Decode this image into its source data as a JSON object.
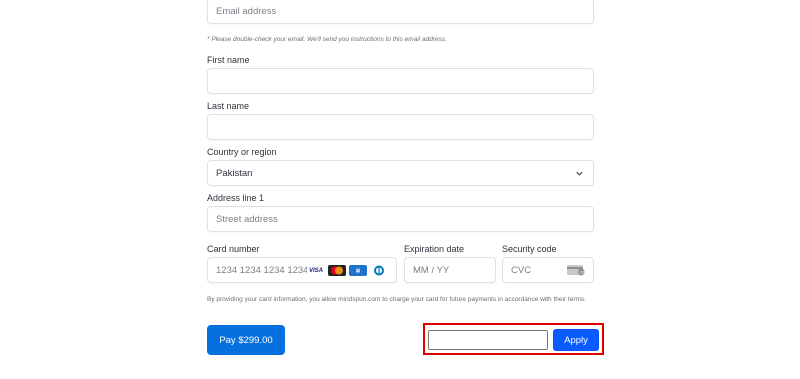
{
  "email": {
    "placeholder": "Email address",
    "note": "* Please double-check your email. We'll send you instructions to this email address."
  },
  "first_name": {
    "label": "First name",
    "value": ""
  },
  "last_name": {
    "label": "Last name",
    "value": ""
  },
  "country": {
    "label": "Country or region",
    "selected": "Pakistan",
    "icon": "chevron-down-icon"
  },
  "address": {
    "label": "Address line 1",
    "placeholder": "Street address"
  },
  "card": {
    "number_label": "Card number",
    "number_placeholder": "1234 1234 1234 1234",
    "brands": [
      "VISA",
      "mastercard",
      "amex",
      "diners"
    ],
    "expiry_label": "Expiration date",
    "expiry_placeholder": "MM / YY",
    "cvc_label": "Security code",
    "cvc_placeholder": "CVC"
  },
  "terms": "By providing your card information, you allow mindspun.com to charge your card for future payments in accordance with their terms.",
  "pay_button": "Pay $299.00",
  "coupon": {
    "value": "",
    "apply_label": "Apply"
  },
  "colors": {
    "primary": "#0570de",
    "apply": "#0a5bff",
    "highlight": "#e00000"
  }
}
